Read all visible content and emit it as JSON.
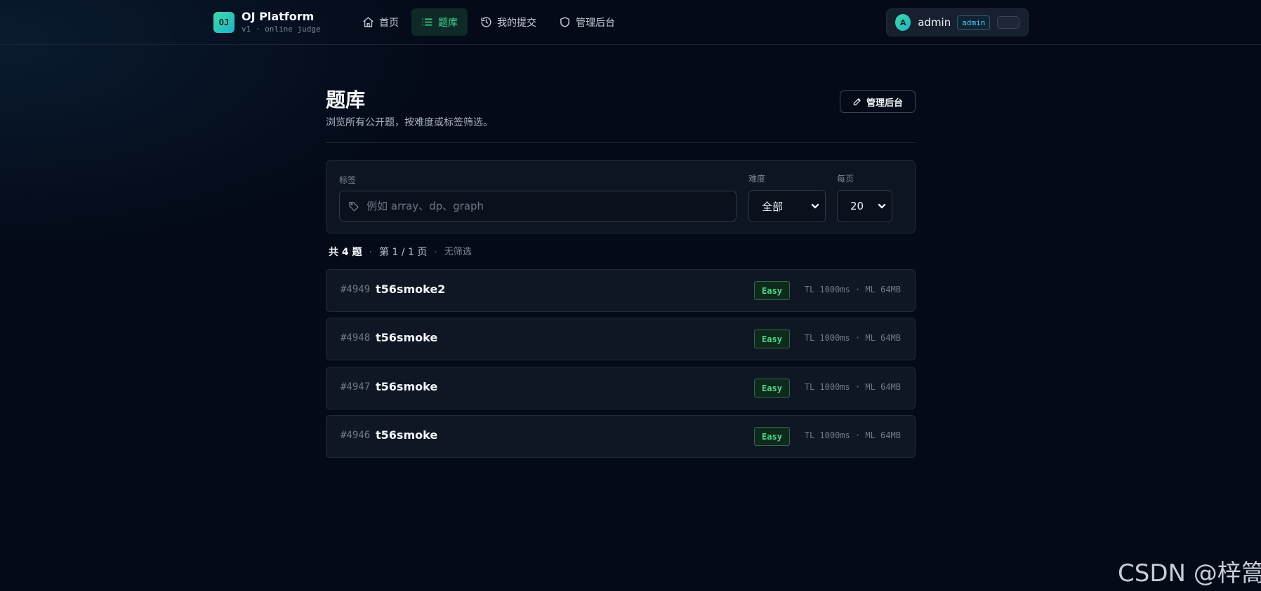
{
  "brand": {
    "logo": "OJ",
    "name": "OJ Platform",
    "subtitle": "v1 · online judge"
  },
  "nav": {
    "items": [
      {
        "label": "首页",
        "icon": "home-icon"
      },
      {
        "label": "题库",
        "icon": "list-icon",
        "active": true
      },
      {
        "label": "我的提交",
        "icon": "history-icon"
      },
      {
        "label": "管理后台",
        "icon": "shield-icon"
      }
    ]
  },
  "user": {
    "avatar": "A",
    "name": "admin",
    "role": "admin"
  },
  "page": {
    "title": "题库",
    "description": "浏览所有公开题，按难度或标签筛选。",
    "admin_button": "管理后台"
  },
  "filters": {
    "tag_label": "标签",
    "tag_placeholder": "例如 array、dp、graph",
    "tag_value": "",
    "difficulty_label": "难度",
    "difficulty_value": "全部",
    "per_page_label": "每页",
    "per_page_value": "20"
  },
  "summary": {
    "total": "共 4 题",
    "page": "第 1 / 1 页",
    "filter": "无筛选"
  },
  "problems": [
    {
      "id": "#4949",
      "title": "t56smoke2",
      "difficulty": "Easy",
      "limits": "TL 1000ms · ML 64MB"
    },
    {
      "id": "#4948",
      "title": "t56smoke",
      "difficulty": "Easy",
      "limits": "TL 1000ms · ML 64MB"
    },
    {
      "id": "#4947",
      "title": "t56smoke",
      "difficulty": "Easy",
      "limits": "TL 1000ms · ML 64MB"
    },
    {
      "id": "#4946",
      "title": "t56smoke",
      "difficulty": "Easy",
      "limits": "TL 1000ms · ML 64MB"
    }
  ],
  "watermark": "CSDN @梓篙",
  "colors": {
    "background": "#040a18",
    "accent": "#3fd99a",
    "easy": "#4cd98a"
  }
}
